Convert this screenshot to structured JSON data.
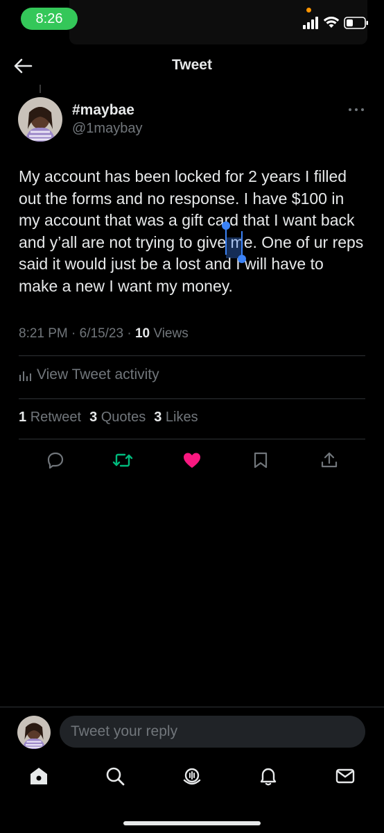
{
  "status_bar": {
    "time": "8:26"
  },
  "header": {
    "title": "Tweet"
  },
  "tweet": {
    "display_name": "#maybae",
    "username": "@1maybay",
    "text": "My account has been locked for 2 years I filled out the forms and no response. I have $100 in my account that was a gift card that I want back and y’all are not trying to give me. One of ur reps said it would just be a lost and I will have to make a new I want my money.",
    "time": "8:21 PM",
    "date": "6/15/23",
    "views_count": "10",
    "views_label": "Views",
    "separator": "·"
  },
  "activity": {
    "label": "View Tweet activity"
  },
  "stats": {
    "retweets_count": "1",
    "retweets_label": "Retweet",
    "quotes_count": "3",
    "quotes_label": "Quotes",
    "likes_count": "3",
    "likes_label": "Likes"
  },
  "actions": {
    "reply_icon": "reply-icon",
    "retweet_icon": "retweet-icon",
    "like_icon": "heart-icon",
    "bookmark_icon": "bookmark-icon",
    "share_icon": "share-icon",
    "retweet_color": "#00ba7c",
    "like_color": "#f91880"
  },
  "reply_bar": {
    "placeholder": "Tweet your reply"
  },
  "bottom_nav": {
    "items": [
      "home-icon",
      "search-icon",
      "spaces-icon",
      "notifications-icon",
      "messages-icon"
    ]
  },
  "colors": {
    "accent": "#1d9bf0",
    "selection": "#3b82f6",
    "status_green": "#34c759"
  }
}
